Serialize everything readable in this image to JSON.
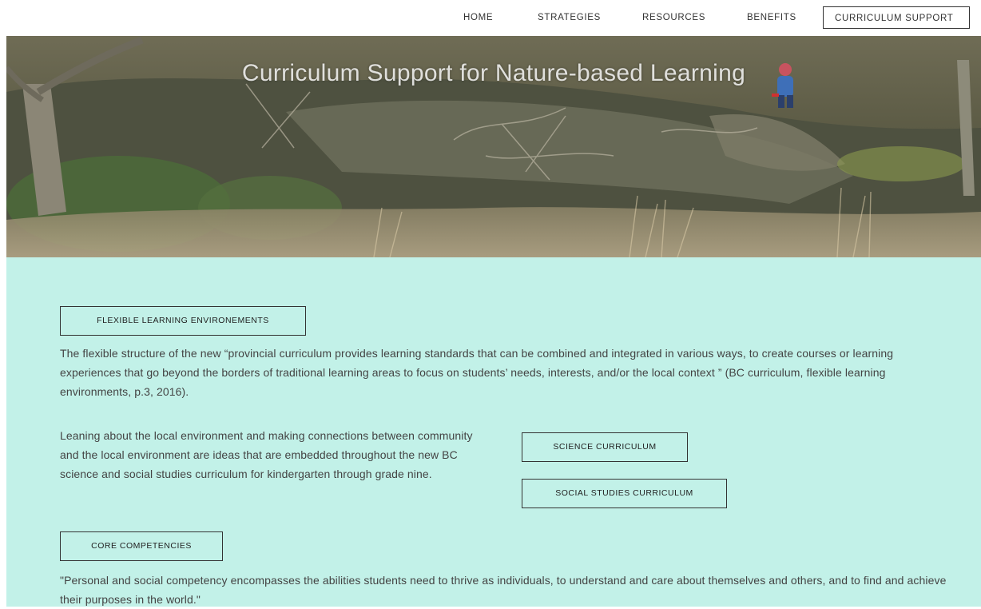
{
  "nav": {
    "items": [
      {
        "label": "HOME"
      },
      {
        "label": "STRATEGIES"
      },
      {
        "label": "RESOURCES"
      },
      {
        "label": "BENEFITS"
      },
      {
        "label": "CURRICULUM SUPPORT",
        "active": true
      }
    ]
  },
  "hero": {
    "title": "Curriculum Support for Nature-based Learning"
  },
  "sections": {
    "flexible": {
      "button_label": "FLEXIBLE LEARNING ENVIRONEMENTS",
      "text": "The flexible structure of the new  “provincial curriculum provides learning standards that can be combined and integrated in various ways, to create courses or learning experiences that go beyond the borders of traditional learning areas to focus on students’ needs, interests, and/or the local context ” (BC curriculum, flexible learning environments, p.3, 2016)."
    },
    "local": {
      "text": "Leaning about the local environment and making connections between community and the local environment are ideas that are embedded throughout the new BC science and social studies curriculum for kindergarten through grade nine.",
      "science_label": "SCIENCE CURRICULUM",
      "social_label": "SOCIAL STUDIES CURRICULUM"
    },
    "core": {
      "button_label": "CORE COMPETENCIES",
      "text": "\"Personal and social competency encompasses the abilities students need to thrive as individuals, to understand and care about themselves and others, and to find and achieve their purposes in the world.\""
    }
  },
  "colors": {
    "content_bg": "#c2f1e8",
    "border": "#333333",
    "text": "#444444"
  }
}
